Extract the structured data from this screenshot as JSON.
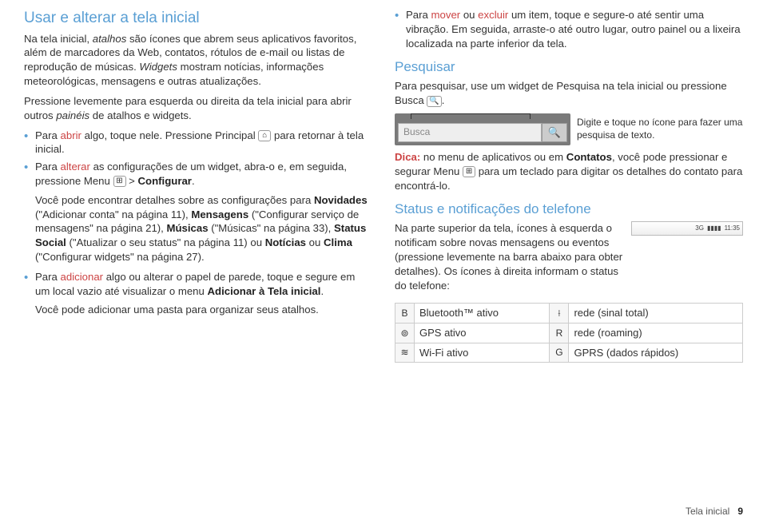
{
  "left": {
    "heading": "Usar e alterar a tela inicial",
    "p1a": "Na tela inicial, ",
    "p1b": " são ícones que abrem seus aplicativos favoritos, além de marcadores da Web, contatos, rótulos de e-mail ou listas de reprodução de músicas. ",
    "p1c": " mostram notícias, informações meteorológicas, mensagens e outras atualizações.",
    "atalhos": "atalhos",
    "widgets": "Widgets",
    "p2": "Pressione levemente para esquerda ou direita da tela inicial para abrir outros ",
    "paineis": "painéis",
    "p2b": " de atalhos e widgets.",
    "li1a": "Para ",
    "abrir": "abrir",
    "li1b": " algo, toque nele. Pressione Principal ",
    "li1c": " para retornar à tela inicial.",
    "li2a": "Para ",
    "alterar": "alterar",
    "li2b": " as configurações de um widget, abra-o e, em seguida, pressione Menu ",
    "li2c": " > ",
    "configurar": "Configurar",
    "li2d": ".",
    "detail": "Você pode encontrar detalhes sobre as configurações para ",
    "novidades": "Novidades",
    "novidades_txt": " (\"Adicionar conta\" na página 11), ",
    "mensagens": "Mensagens",
    "mensagens_txt": " (\"Configurar serviço de mensagens\" na página 21), ",
    "musicas": "Músicas",
    "musicas_txt": " (\"Músicas\" na página 33), ",
    "status_social": "Status Social",
    "status_social_txt": " (\"Atualizar o seu status\" na página 11) ou ",
    "noticias": "Notícias",
    "ou": " ou ",
    "clima": "Clima",
    "clima_txt": " (\"Configurar widgets\" na página 27).",
    "li3a": "Para ",
    "adicionar": "adicionar",
    "li3b": " algo ou alterar o papel de parede, toque e segure em um local vazio até visualizar o menu ",
    "add_tela": "Adicionar à Tela inicial",
    "li3c": ".",
    "pasta": "Você pode adicionar uma pasta para organizar seus atalhos."
  },
  "right": {
    "move_a": "Para ",
    "mover": "mover",
    "move_ou": " ou ",
    "excluir": "excluir",
    "move_b": " um item, toque e segure-o até sentir uma vibração. Em seguida, arraste-o até outro lugar, outro painel ou a lixeira localizada na parte inferior da tela.",
    "pesquisar": "Pesquisar",
    "pesq_p": "Para pesquisar, use um widget de Pesquisa na tela inicial ou pressione Busca ",
    "pesq_p2": ".",
    "search_placeholder": "Busca",
    "fig_caption": "Digite e toque no ícone para fazer uma pesquisa de texto.",
    "dica_label": "Dica:",
    "dica_a": " no menu de aplicativos ou em ",
    "contatos": "Contatos",
    "dica_b": ", você pode pressionar e segurar Menu ",
    "dica_c": " para um teclado para digitar os detalhes do contato para encontrá-lo.",
    "status_heading": "Status e notificações do telefone",
    "status_p": "Na parte superior da tela, ícones à esquerda o notificam sobre novas mensagens ou eventos (pressione levemente na barra abaixo para obter detalhes). Os ícones à direita informam o status do telefone:",
    "bar_time": "11:35",
    "bar_3g": "3G",
    "table": {
      "bt": "Bluetooth™ ativo",
      "gps": "GPS ativo",
      "wifi": "Wi-Fi ativo",
      "sinal": "rede (sinal total)",
      "roaming": "rede (roaming)",
      "gprs": "GPRS (dados rápidos)"
    }
  },
  "icons": {
    "home": "⌂",
    "menu": "⊞",
    "search": "🔍",
    "bt": "B",
    "gps": "⊚",
    "wifi": "≋",
    "signal": "⟊",
    "roam": "R",
    "gprs": "G"
  },
  "footer": {
    "label": "Tela inicial",
    "page": "9"
  }
}
